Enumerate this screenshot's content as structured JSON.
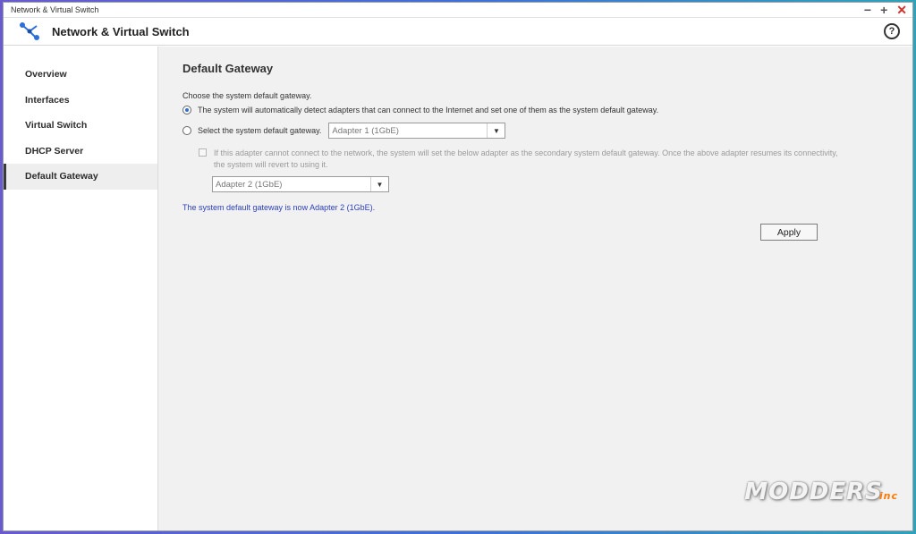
{
  "window": {
    "title": "Network & Virtual Switch",
    "controls": {
      "minimize": "−",
      "maximize": "+",
      "close": "✕"
    }
  },
  "app": {
    "title": "Network & Virtual Switch",
    "icon": "network-switch-icon",
    "help": "?"
  },
  "sidebar": {
    "items": [
      {
        "label": "Overview"
      },
      {
        "label": "Interfaces"
      },
      {
        "label": "Virtual Switch"
      },
      {
        "label": "DHCP Server"
      },
      {
        "label": "Default Gateway",
        "active": true
      }
    ]
  },
  "main": {
    "title": "Default Gateway",
    "intro": "Choose the system default gateway.",
    "option_auto": "The system will automatically detect adapters that can connect to the Internet and set one of them as the system default gateway.",
    "option_manual": "Select the system default gateway.",
    "primary_adapter": "Adapter 1 (1GbE)",
    "secondary_text_line1": "If this adapter cannot connect to the network, the system will set the below adapter as the secondary system default gateway. Once the above adapter resumes its connectivity,",
    "secondary_text_line2": "the system will revert to using it.",
    "secondary_adapter": "Adapter 2 (1GbE)",
    "status": "The system default gateway is now Adapter 2 (1GbE).",
    "apply_label": "Apply"
  },
  "watermark": {
    "text": "MODDERS",
    "suffix": "inc"
  },
  "colors": {
    "accent": "#2c6fd6",
    "status_text": "#2b3fb8",
    "close": "#d0312d"
  }
}
